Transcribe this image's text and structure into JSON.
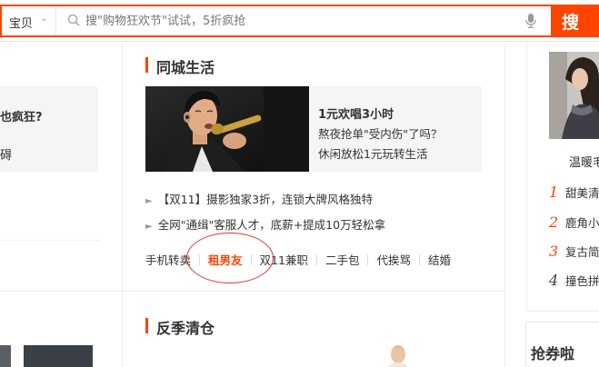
{
  "search": {
    "scope_label": "宝贝",
    "placeholder": "搜\"购物狂欢节\"试试，5折疯抢",
    "button_label": "搜"
  },
  "left_column": {
    "headline": "也疯狂?",
    "subline": "碍"
  },
  "local_life": {
    "title": "同城生活",
    "feature": {
      "title": "1元欢唱3小时",
      "line1": "熬夜抢单\"受内伤\"了吗？",
      "line2": "休闲放松1元玩转生活"
    },
    "list": [
      "【双11】摄影独家3折，连锁大牌风格独特",
      "全网\"通缉\"客服人才，底薪+提成10万轻松拿"
    ],
    "tags": [
      {
        "label": "手机转卖",
        "highlight": false
      },
      {
        "label": "租男友",
        "highlight": true
      },
      {
        "label": "双11兼职",
        "highlight": false
      },
      {
        "label": "二手包",
        "highlight": false
      },
      {
        "label": "代挨骂",
        "highlight": false
      },
      {
        "label": "结婚",
        "highlight": false
      }
    ]
  },
  "clearance": {
    "title": "反季清仓"
  },
  "right_column": {
    "caption": "温暖毛",
    "ranks": [
      {
        "num": "1",
        "text": "甜美清"
      },
      {
        "num": "2",
        "text": "鹿角小"
      },
      {
        "num": "3",
        "text": "复古简"
      },
      {
        "num": "4",
        "text": "撞色拼"
      }
    ],
    "coupon_title": "抢券啦"
  },
  "colors": {
    "accent": "#ff4400",
    "annotation_circle": "#dd3333",
    "card_bg": "#f5f5f5"
  },
  "icons": [
    "search-icon",
    "microphone-icon",
    "chevron-down-icon",
    "arrow-right-icon"
  ]
}
